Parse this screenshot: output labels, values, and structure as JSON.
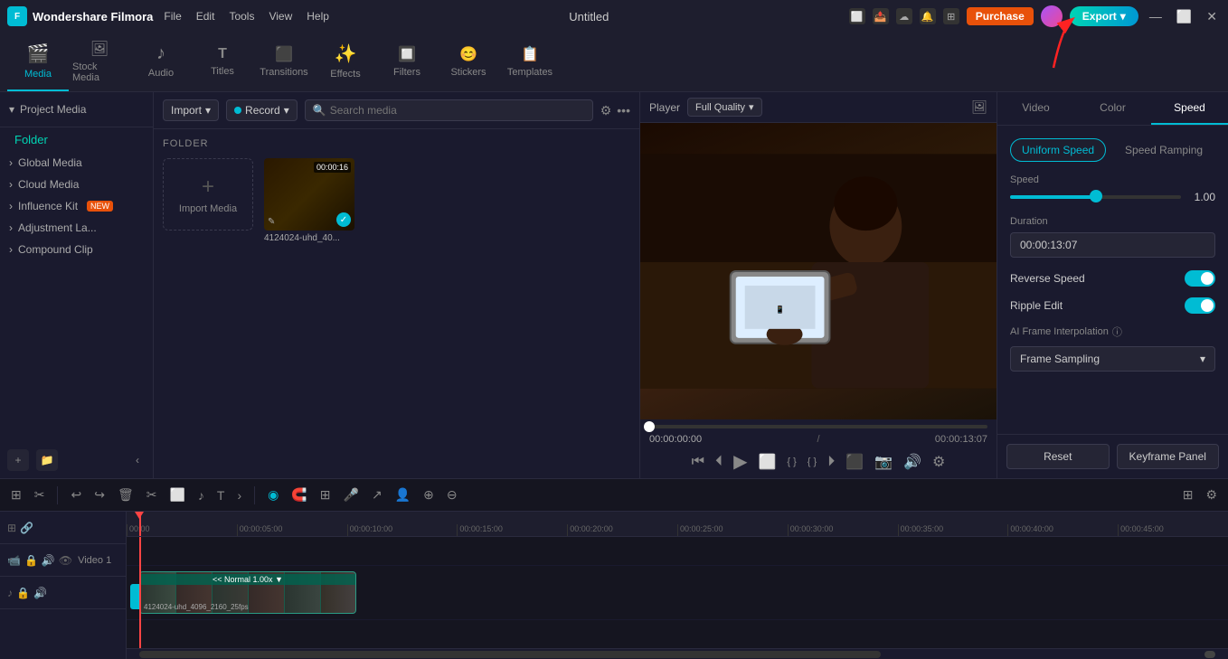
{
  "app": {
    "name": "Wondershare Filmora",
    "title": "Untitled",
    "logo_bg": "#00bcd4"
  },
  "titlebar": {
    "menu": [
      "File",
      "Edit",
      "Tools",
      "View",
      "Help"
    ],
    "purchase_label": "Purchase",
    "export_label": "Export"
  },
  "toolbar": {
    "items": [
      {
        "id": "media",
        "label": "Media",
        "icon": "🎬",
        "active": true
      },
      {
        "id": "stock_media",
        "label": "Stock Media",
        "icon": "🎵"
      },
      {
        "id": "audio",
        "label": "Audio",
        "icon": "🎵"
      },
      {
        "id": "titles",
        "label": "Titles",
        "icon": "T"
      },
      {
        "id": "transitions",
        "label": "Transitions",
        "icon": "⬛"
      },
      {
        "id": "effects",
        "label": "Effects",
        "icon": "✨"
      },
      {
        "id": "filters",
        "label": "Filters",
        "icon": "🔲"
      },
      {
        "id": "stickers",
        "label": "Stickers",
        "icon": "😊"
      },
      {
        "id": "templates",
        "label": "Templates",
        "icon": "📋"
      }
    ]
  },
  "sidebar": {
    "section_label": "Project Media",
    "folder_label": "Folder",
    "items": [
      {
        "label": "Global Media",
        "has_arrow": true
      },
      {
        "label": "Cloud Media",
        "has_arrow": true
      },
      {
        "label": "Influence Kit",
        "has_arrow": true,
        "badge": "NEW"
      },
      {
        "label": "Adjustment La...",
        "has_arrow": true
      },
      {
        "label": "Compound Clip",
        "has_arrow": true
      }
    ]
  },
  "media_panel": {
    "import_label": "Import",
    "record_label": "Record",
    "search_placeholder": "Search media",
    "folder_header": "FOLDER",
    "import_media_label": "Import Media",
    "file": {
      "name": "4124024-uhd_40...",
      "duration": "00:00:16"
    }
  },
  "preview": {
    "player_label": "Player",
    "quality_label": "Full Quality",
    "time_current": "00:00:00:00",
    "time_separator": "/",
    "time_total": "00:00:13:07"
  },
  "right_panel": {
    "tabs": [
      "Video",
      "Color",
      "Speed"
    ],
    "active_tab": "Speed",
    "speed_tabs": [
      "Uniform Speed",
      "Speed Ramping"
    ],
    "active_speed_tab": "Uniform Speed",
    "speed_label": "Speed",
    "speed_value": "1.00",
    "duration_label": "Duration",
    "duration_value": "00:00:13:07",
    "reverse_speed_label": "Reverse Speed",
    "ripple_edit_label": "Ripple Edit",
    "ai_frame_label": "AI Frame Interpolation",
    "frame_sampling_label": "Frame Sampling",
    "reset_label": "Reset",
    "keyframe_label": "Keyframe Panel"
  },
  "timeline": {
    "tracks": [
      {
        "id": "video1",
        "label": "Video 1"
      },
      {
        "id": "audio1",
        "label": ""
      }
    ],
    "ruler_marks": [
      "00:00",
      "00:00:05:00",
      "00:00:10:00",
      "00:00:15:00",
      "00:00:20:00",
      "00:00:25:00",
      "00:00:30:00",
      "00:00:35:00",
      "00:00:40:00",
      "00:00:45:00"
    ],
    "clip": {
      "label": "<< Normal 1.00x ▼",
      "bottom_label": "4124024-uhd_4096_2160_25fps"
    }
  },
  "icons": {
    "chevron_down": "▾",
    "chevron_right": "›",
    "check": "✓",
    "plus": "+",
    "search": "🔍",
    "filter": "⚙",
    "dots": "•••",
    "record_dot": "●",
    "undo": "↩",
    "redo": "↪",
    "delete": "🗑",
    "cut": "✂",
    "crop": "⬜",
    "audio": "♪",
    "text": "T",
    "more": "›",
    "magnet": "🧲",
    "snap": "⊞",
    "mark": "◉",
    "mic": "🎤",
    "arrow": "↗",
    "timeline_add": "⊕",
    "timeline_minus": "⊖",
    "grid": "⊞",
    "settings": "⚙"
  }
}
